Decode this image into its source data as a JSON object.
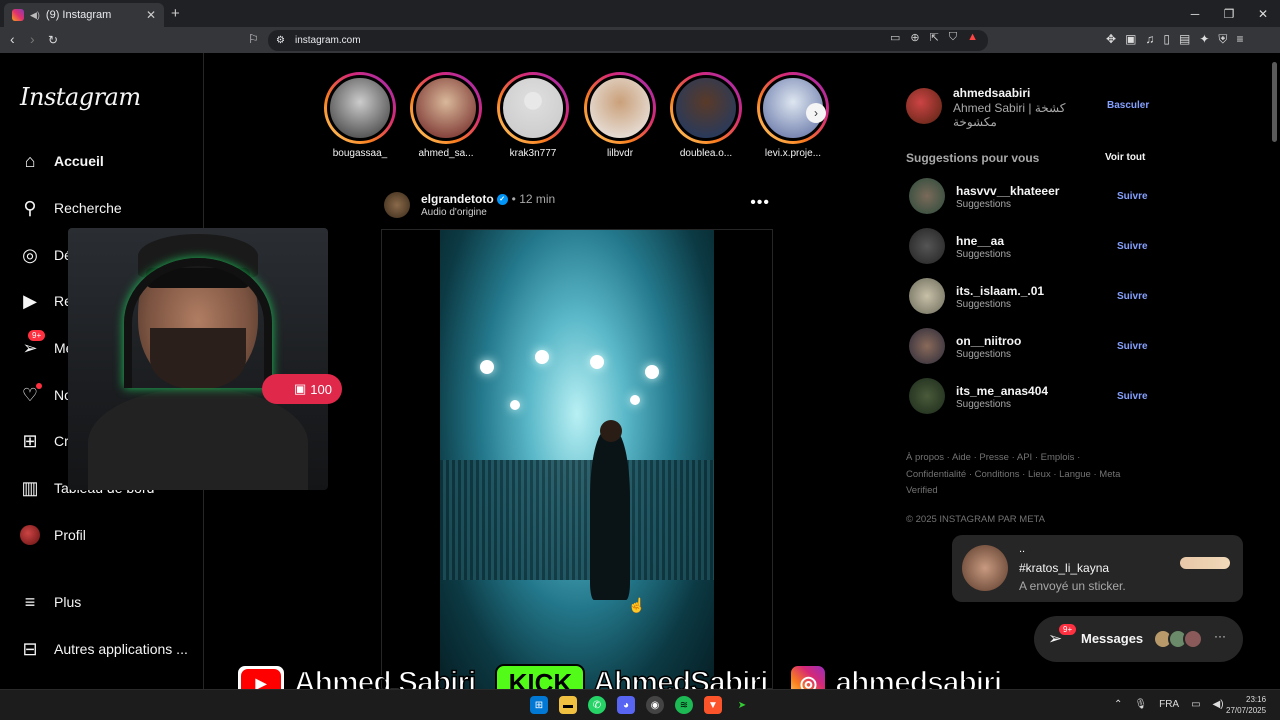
{
  "browser": {
    "tab_title": "(9) Instagram",
    "url": "instagram.com"
  },
  "sidebar": {
    "logo": "Instagram",
    "items": [
      {
        "label": "Accueil",
        "icon": "home-icon"
      },
      {
        "label": "Recherche",
        "icon": "search-icon"
      },
      {
        "label": "Découvrir",
        "icon": "compass-icon"
      },
      {
        "label": "Reels",
        "icon": "reels-icon"
      },
      {
        "label": "Messages",
        "icon": "messenger-icon",
        "badge": "9+"
      },
      {
        "label": "Notifications",
        "icon": "heart-icon"
      },
      {
        "label": "Créer",
        "icon": "plus-square-icon"
      },
      {
        "label": "Tableau de bord",
        "icon": "dashboard-icon"
      },
      {
        "label": "Profil",
        "icon": "avatar"
      },
      {
        "label": "Plus",
        "icon": "menu-icon"
      },
      {
        "label": "Autres applications ...",
        "icon": "apps-icon"
      }
    ]
  },
  "overlay": {
    "sub_count": "100"
  },
  "stories": [
    {
      "username": "bougassaa_"
    },
    {
      "username": "ahmed_sa..."
    },
    {
      "username": "krak3n777"
    },
    {
      "username": "lilbvdr"
    },
    {
      "username": "doublea.o..."
    },
    {
      "username": "levi.x.proje..."
    }
  ],
  "post": {
    "username": "elgrandetoto",
    "time": "• 12 min",
    "audio": "Audio d'origine"
  },
  "account": {
    "username": "ahmedsaabiri",
    "name": "Ahmed Sabiri | كشخة مكشوخة",
    "switch_label": "Basculer"
  },
  "suggestions": {
    "title": "Suggestions pour vous",
    "see_all": "Voir tout",
    "items": [
      {
        "username": "hasvvv__khateeer",
        "sub": "Suggestions",
        "action": "Suivre"
      },
      {
        "username": "hne__aa",
        "sub": "Suggestions",
        "action": "Suivre"
      },
      {
        "username": "its._islaam._.01",
        "sub": "Suggestions",
        "action": "Suivre"
      },
      {
        "username": "on__niitroo",
        "sub": "Suggestions",
        "action": "Suivre"
      },
      {
        "username": "its_me_anas404",
        "sub": "Suggestions",
        "action": "Suivre"
      }
    ]
  },
  "footer": {
    "links": "À propos · Aide · Presse · API · Emplois · Confidentialité · Conditions · Lieux · Langue · Meta Verified",
    "copyright": "© 2025 INSTAGRAM PAR META"
  },
  "notification": {
    "line1": "..",
    "line2": "#kratos_li_kayna",
    "line3": "A envoyé un sticker."
  },
  "messages_pill": {
    "label": "Messages",
    "badge": "9+"
  },
  "banner": {
    "youtube": "Ahmed Sabiri",
    "kick_logo": "KICK",
    "kick": "AhmedSabiri",
    "instagram": "ahmedsabiri"
  },
  "taskbar": {
    "lang": "FRA",
    "time": "23:16",
    "date": "27/07/2025"
  }
}
